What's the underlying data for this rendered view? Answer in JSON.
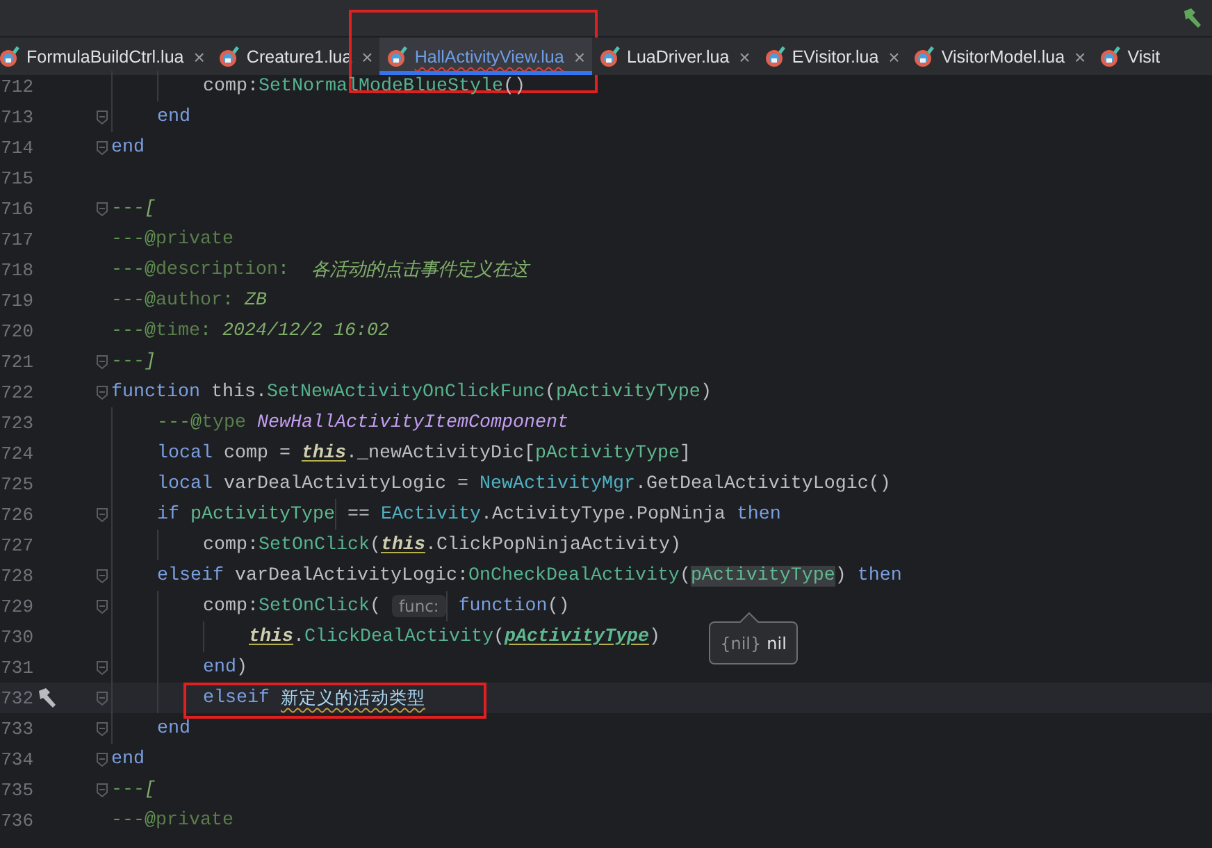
{
  "tabs": [
    {
      "label": "FormulaBuildCtrl.lua",
      "close": "×",
      "selected": false,
      "error": false,
      "annotated": false
    },
    {
      "label": "Creature1.lua",
      "close": "×",
      "selected": false,
      "error": false,
      "annotated": false
    },
    {
      "label": "HallActivityView.lua",
      "close": "×",
      "selected": true,
      "error": true,
      "annotated": true
    },
    {
      "label": "LuaDriver.lua",
      "close": "×",
      "selected": false,
      "error": false,
      "annotated": false
    },
    {
      "label": "EVisitor.lua",
      "close": "×",
      "selected": false,
      "error": false,
      "annotated": false
    },
    {
      "label": "VisitorModel.lua",
      "close": "×",
      "selected": false,
      "error": false,
      "annotated": false
    },
    {
      "label": "Visit",
      "selected": false,
      "error": false,
      "annotated": false
    }
  ],
  "lines": [
    {
      "number": "712",
      "fold": false,
      "current": false,
      "annotated": false,
      "tokens": [
        {
          "kind": "plain",
          "text": "        comp:"
        },
        {
          "kind": "fn",
          "text": "SetNormalModeBlueStyle"
        },
        {
          "kind": "plain",
          "text": "()"
        }
      ]
    },
    {
      "number": "713",
      "fold": true,
      "current": false,
      "annotated": false,
      "tokens": [
        {
          "kind": "kw",
          "text": "    end"
        }
      ]
    },
    {
      "number": "714",
      "fold": true,
      "current": false,
      "annotated": false,
      "tokens": [
        {
          "kind": "kw",
          "text": "end"
        }
      ]
    },
    {
      "number": "715",
      "fold": false,
      "current": false,
      "annotated": false
    },
    {
      "number": "716",
      "fold": true,
      "current": false,
      "annotated": false,
      "tokens": [
        {
          "kind": "com",
          "text": "---"
        },
        {
          "kind": "comi",
          "text": "["
        }
      ]
    },
    {
      "number": "717",
      "fold": false,
      "current": false,
      "annotated": false,
      "tokens": [
        {
          "kind": "com",
          "text": "---@"
        },
        {
          "kind": "tag",
          "text": "private"
        }
      ]
    },
    {
      "number": "718",
      "fold": false,
      "current": false,
      "annotated": false,
      "tokens": [
        {
          "kind": "com",
          "text": "---@"
        },
        {
          "kind": "tag",
          "text": "description"
        },
        {
          "kind": "com",
          "text": ":  "
        },
        {
          "kind": "comi",
          "text": "各活动的点击事件定义在这"
        }
      ]
    },
    {
      "number": "719",
      "fold": false,
      "current": false,
      "annotated": false,
      "tokens": [
        {
          "kind": "com",
          "text": "---@"
        },
        {
          "kind": "tag",
          "text": "author"
        },
        {
          "kind": "com",
          "text": ": "
        },
        {
          "kind": "comi",
          "text": "ZB"
        }
      ]
    },
    {
      "number": "720",
      "fold": false,
      "current": false,
      "annotated": false,
      "tokens": [
        {
          "kind": "com",
          "text": "---@"
        },
        {
          "kind": "tag",
          "text": "time"
        },
        {
          "kind": "com",
          "text": ": "
        },
        {
          "kind": "comi",
          "text": "2024/12/2 16:02"
        }
      ]
    },
    {
      "number": "721",
      "fold": true,
      "current": false,
      "annotated": false,
      "tokens": [
        {
          "kind": "com",
          "text": "---"
        },
        {
          "kind": "comi",
          "text": "]"
        }
      ]
    },
    {
      "number": "722",
      "fold": true,
      "current": false,
      "annotated": false,
      "tokens": [
        {
          "kind": "kw",
          "text": "function "
        },
        {
          "kind": "plain",
          "text": "this."
        },
        {
          "kind": "fn",
          "text": "SetNewActivityOnClickFunc"
        },
        {
          "kind": "plain",
          "text": "("
        },
        {
          "kind": "param",
          "text": "pActivityType"
        },
        {
          "kind": "plain",
          "text": ")"
        }
      ]
    },
    {
      "number": "723",
      "fold": false,
      "current": false,
      "annotated": false,
      "tokens": [
        {
          "kind": "com",
          "text": "    ---@"
        },
        {
          "kind": "tag",
          "text": "type "
        },
        {
          "kind": "type",
          "text": "NewHallActivityItemComponent"
        }
      ]
    },
    {
      "number": "724",
      "fold": false,
      "current": false,
      "annotated": false,
      "tokens": [
        {
          "kind": "kw",
          "text": "    local "
        },
        {
          "kind": "plain",
          "text": "comp = "
        },
        {
          "kind": "this",
          "text": "this"
        },
        {
          "kind": "plain",
          "text": "._newActivityDic["
        },
        {
          "kind": "param",
          "text": "pActivityType"
        },
        {
          "kind": "plain",
          "text": "]"
        }
      ]
    },
    {
      "number": "725",
      "fold": false,
      "current": false,
      "annotated": false,
      "tokens": [
        {
          "kind": "kw",
          "text": "    local "
        },
        {
          "kind": "plain",
          "text": "varDealActivityLogic = "
        },
        {
          "kind": "cls",
          "text": "NewActivityMgr"
        },
        {
          "kind": "plain",
          "text": ".GetDealActivityLogic()"
        }
      ]
    },
    {
      "number": "726",
      "fold": true,
      "current": false,
      "annotated": false,
      "tokens": [
        {
          "kind": "kw",
          "text": "    if "
        },
        {
          "kind": "param",
          "text": "pActivityType"
        },
        {
          "kind": "plain",
          "text": " == "
        },
        {
          "kind": "cls",
          "text": "EActivity"
        },
        {
          "kind": "plain",
          "text": ".ActivityType.PopNinja "
        },
        {
          "kind": "kw",
          "text": "then"
        }
      ]
    },
    {
      "number": "727",
      "fold": false,
      "current": false,
      "annotated": false,
      "tokens": [
        {
          "kind": "plain",
          "text": "        comp:"
        },
        {
          "kind": "fn",
          "text": "SetOnClick"
        },
        {
          "kind": "plain",
          "text": "("
        },
        {
          "kind": "this",
          "text": "this"
        },
        {
          "kind": "plain",
          "text": ".ClickPopNinjaActivity)"
        }
      ]
    },
    {
      "number": "728",
      "fold": true,
      "current": false,
      "annotated": false,
      "tokens": [
        {
          "kind": "kw",
          "text": "    elseif "
        },
        {
          "kind": "plain",
          "text": "varDealActivityLogic:"
        },
        {
          "kind": "fn",
          "text": "OnCheckDealActivity"
        },
        {
          "kind": "plain",
          "text": "("
        },
        {
          "kind": "hl",
          "text": "pActivityType"
        },
        {
          "kind": "plain",
          "text": ") "
        },
        {
          "kind": "kw",
          "text": "then"
        }
      ]
    },
    {
      "number": "729",
      "fold": true,
      "current": false,
      "annotated": false,
      "tokens": [
        {
          "kind": "plain",
          "text": "        comp:"
        },
        {
          "kind": "fn",
          "text": "SetOnClick"
        },
        {
          "kind": "plain",
          "text": "( "
        },
        {
          "kind": "hint",
          "text": "func:"
        },
        {
          "kind": "kw",
          "text": " function"
        },
        {
          "kind": "plain",
          "text": "()"
        }
      ]
    },
    {
      "number": "730",
      "fold": false,
      "current": false,
      "annotated": false,
      "tokens": [
        {
          "kind": "this",
          "text": "            this"
        },
        {
          "kind": "plain",
          "text": "."
        },
        {
          "kind": "fn",
          "text": "ClickDealActivity"
        },
        {
          "kind": "plain",
          "text": "("
        },
        {
          "kind": "parami",
          "text": "pActivityType"
        },
        {
          "kind": "plain",
          "text": ")"
        }
      ]
    },
    {
      "number": "731",
      "fold": true,
      "current": false,
      "annotated": false,
      "tokens": [
        {
          "kind": "kw",
          "text": "        end"
        },
        {
          "kind": "plain",
          "text": ")"
        }
      ]
    },
    {
      "number": "732",
      "fold": true,
      "current": true,
      "annotated": true,
      "tokens": [
        {
          "kind": "kw",
          "text": "        elseif "
        },
        {
          "kind": "err",
          "text": "新定义的活动类型"
        }
      ]
    },
    {
      "number": "733",
      "fold": true,
      "current": false,
      "annotated": false,
      "tokens": [
        {
          "kind": "kw",
          "text": "    end"
        }
      ]
    },
    {
      "number": "734",
      "fold": true,
      "current": false,
      "annotated": false,
      "tokens": [
        {
          "kind": "kw",
          "text": "end"
        }
      ]
    },
    {
      "number": "735",
      "fold": true,
      "current": false,
      "annotated": false,
      "tokens": [
        {
          "kind": "com",
          "text": "---"
        },
        {
          "kind": "comi",
          "text": "["
        }
      ]
    },
    {
      "number": "736",
      "fold": false,
      "current": false,
      "annotated": false,
      "tokens": [
        {
          "kind": "com",
          "text": "---@"
        },
        {
          "kind": "tag",
          "text": "private"
        }
      ]
    }
  ],
  "tooltip": {
    "type": "{nil}",
    "value": "nil"
  }
}
